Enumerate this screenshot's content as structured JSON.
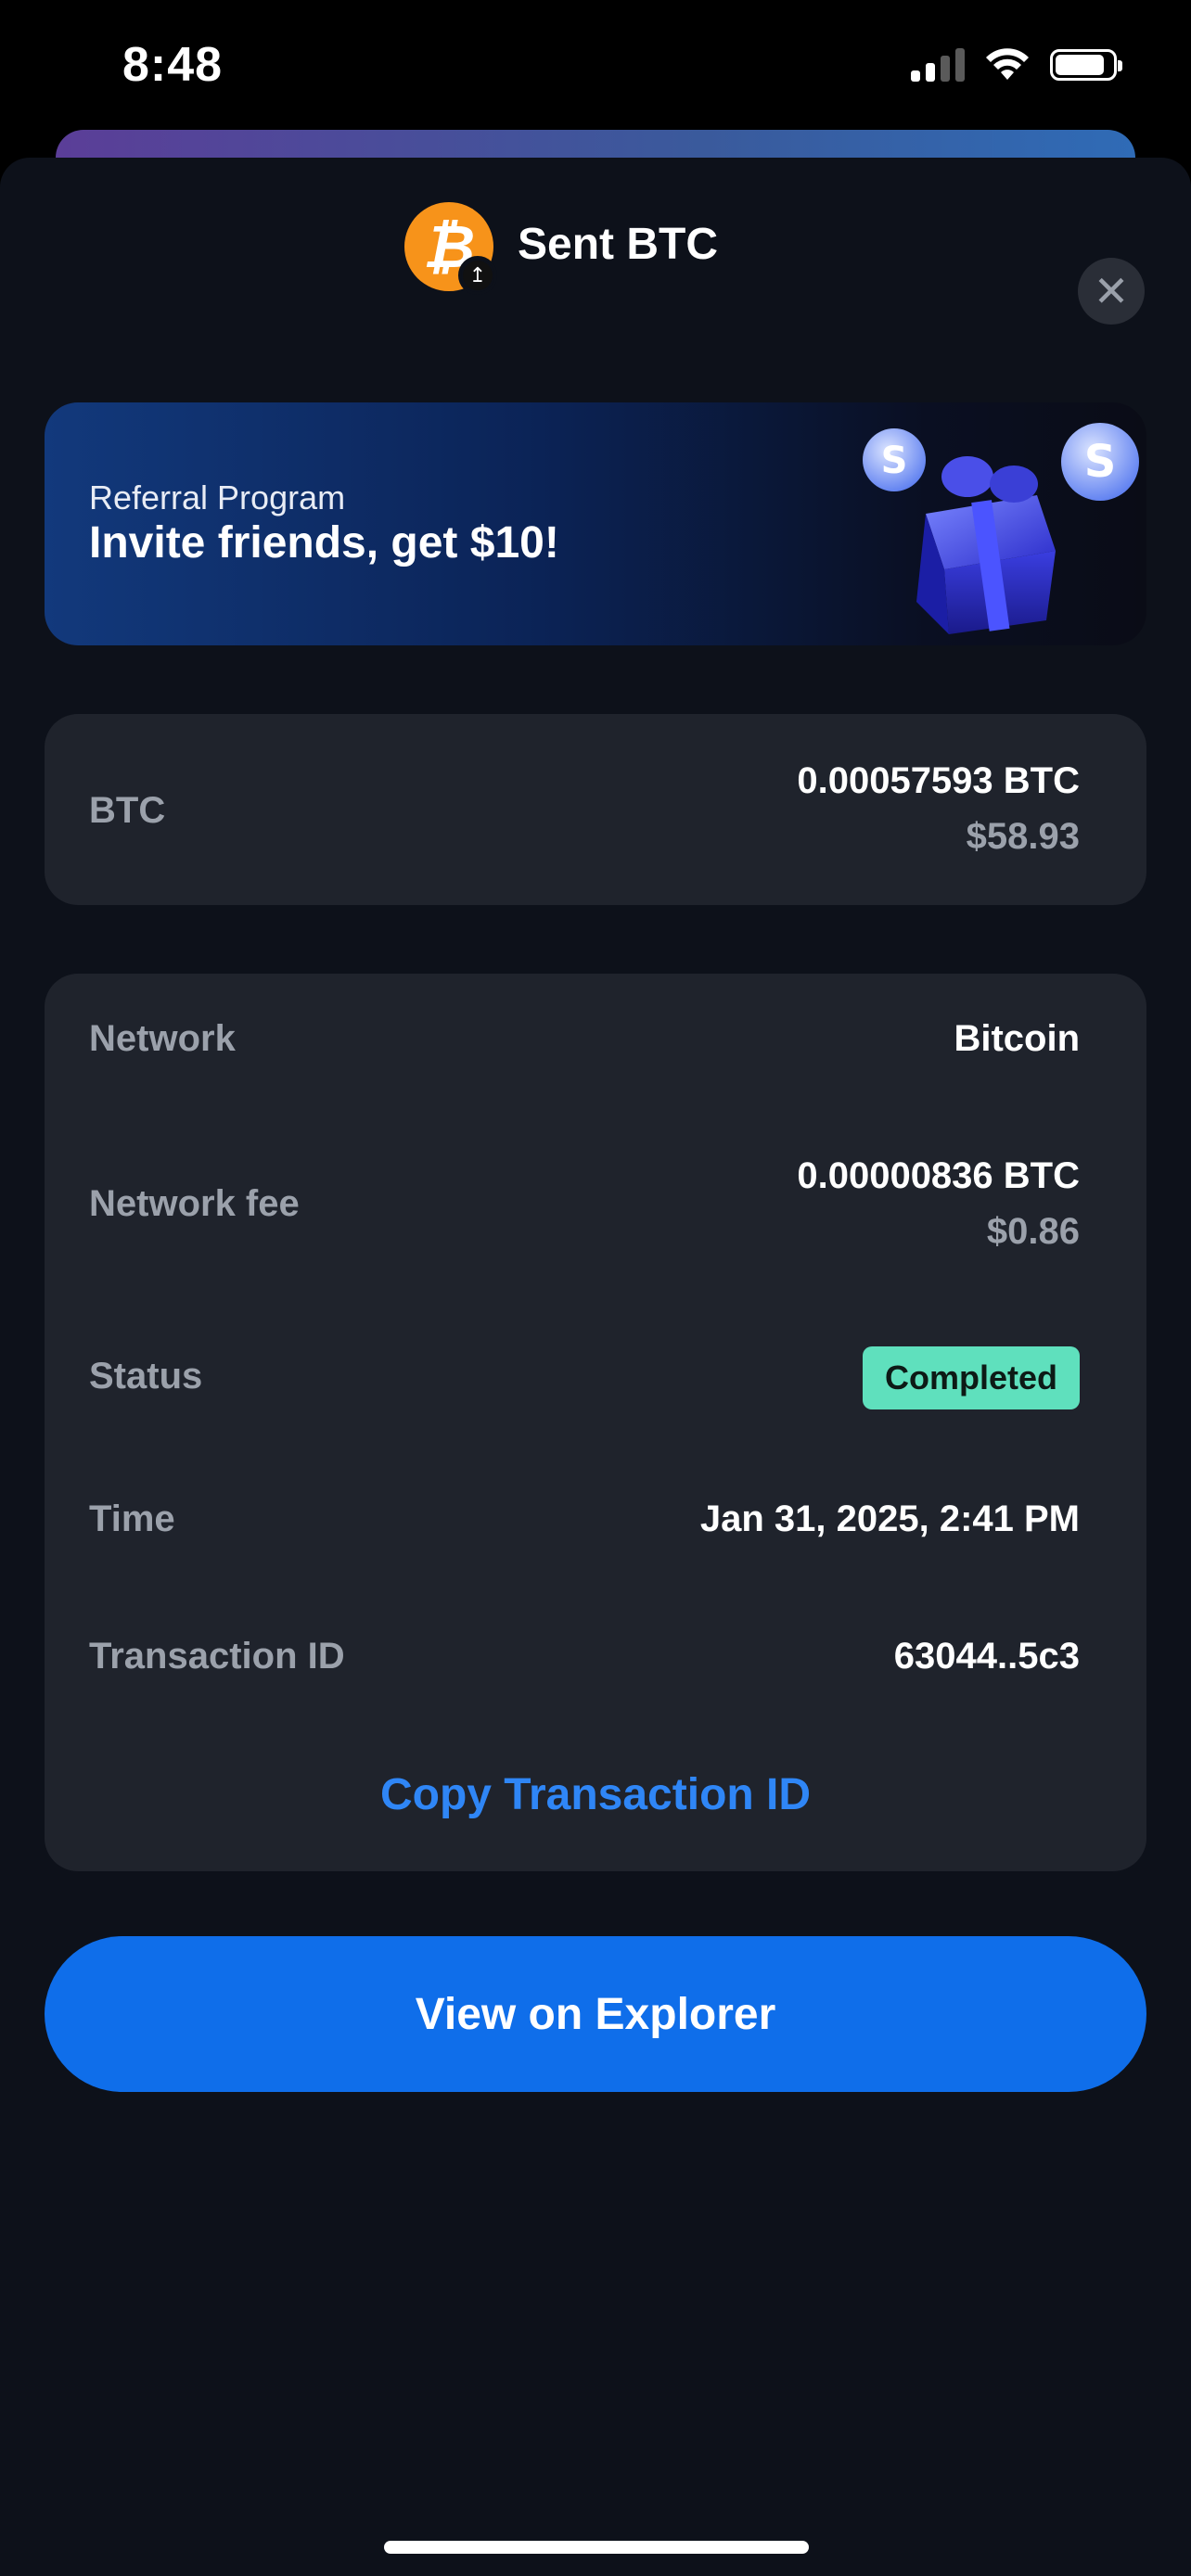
{
  "status_bar": {
    "time": "8:48"
  },
  "header": {
    "title": "Sent BTC",
    "coin_symbol": "₿",
    "direction_icon": "arrow-up-icon",
    "close_icon": "close-icon"
  },
  "referral": {
    "subtitle": "Referral Program",
    "title": "Invite friends, get $10!"
  },
  "amount_card": {
    "label": "BTC",
    "amount": "0.00057593 BTC",
    "fiat": "$58.93"
  },
  "details": {
    "network_label": "Network",
    "network_value": "Bitcoin",
    "fee_label": "Network fee",
    "fee_amount": "0.00000836 BTC",
    "fee_fiat": "$0.86",
    "status_label": "Status",
    "status_value": "Completed",
    "time_label": "Time",
    "time_value": "Jan 31, 2025, 2:41 PM",
    "txid_label": "Transaction ID",
    "txid_value": "63044..5c3",
    "copy_label": "Copy Transaction ID"
  },
  "explorer_button": {
    "label": "View on Explorer"
  },
  "colors": {
    "accent": "#0f6eea",
    "link": "#2f86f6",
    "status_completed": "#5fe0bd",
    "bitcoin": "#f7931a",
    "sheet": "#0d111a",
    "card": "#1f232c"
  }
}
